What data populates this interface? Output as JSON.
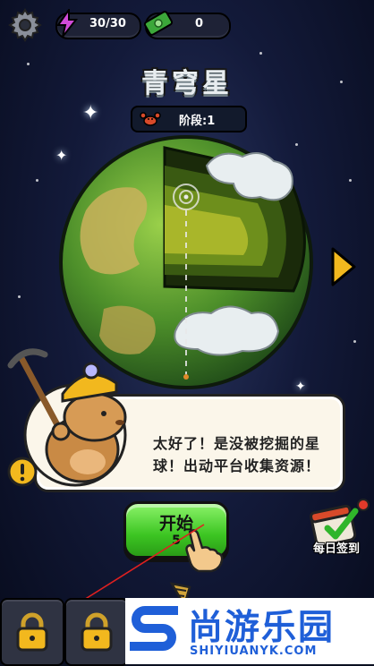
{
  "hud": {
    "energy": "30/30",
    "cash": "0"
  },
  "planet": {
    "name": "青穹星",
    "stage": "阶段:1"
  },
  "dialog": {
    "text": "太好了！是没被挖掘的星球！出动平台收集资源！"
  },
  "actions": {
    "start_label": "开始",
    "start_sub": "5",
    "daily_label": "每日签到"
  },
  "watermark": {
    "cn": "尚游乐园",
    "en": "SHIYIUANYK.COM"
  },
  "colors": {
    "start_button": "#3cc522",
    "energy_icon": "#d14bd8",
    "cash_icon": "#3ca83a",
    "watermark": "#1f5fd8"
  },
  "icons": [
    "gear-icon",
    "lightning-icon",
    "cash-icon",
    "crab-icon",
    "arrow-right-icon",
    "warning-icon",
    "hand-pointer-icon",
    "calendar-check-icon",
    "lock-icon",
    "drill-icon"
  ]
}
